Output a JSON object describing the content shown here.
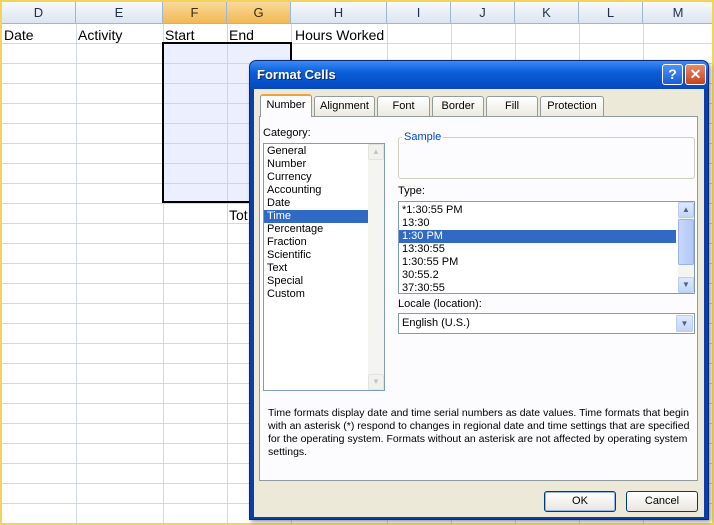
{
  "sheet": {
    "columns": [
      {
        "id": "D",
        "label": "D",
        "selected": false
      },
      {
        "id": "E",
        "label": "E",
        "selected": false
      },
      {
        "id": "F",
        "label": "F",
        "selected": true
      },
      {
        "id": "G",
        "label": "G",
        "selected": true
      },
      {
        "id": "H",
        "label": "H",
        "selected": false
      },
      {
        "id": "I",
        "label": "I",
        "selected": false
      },
      {
        "id": "J",
        "label": "J",
        "selected": false
      },
      {
        "id": "K",
        "label": "K",
        "selected": false
      },
      {
        "id": "L",
        "label": "L",
        "selected": false
      },
      {
        "id": "M",
        "label": "M",
        "selected": false
      }
    ],
    "cells": {
      "D1": "Date",
      "E1": "Activity",
      "F1": "Start",
      "G1": "End",
      "H1": "Hours Worked",
      "G10": "Tot"
    },
    "selection_color": "#000000",
    "header_selected_color": "#f1b953",
    "border_color": "#f2d35c"
  },
  "dialog": {
    "title": "Format Cells",
    "help_label": "?",
    "close_label": "✕",
    "tabs": [
      {
        "id": "number",
        "label": "Number",
        "active": true
      },
      {
        "id": "alignment",
        "label": "Alignment",
        "active": false
      },
      {
        "id": "font",
        "label": "Font",
        "active": false
      },
      {
        "id": "border",
        "label": "Border",
        "active": false
      },
      {
        "id": "fill",
        "label": "Fill",
        "active": false
      },
      {
        "id": "protection",
        "label": "Protection",
        "active": false
      }
    ],
    "category": {
      "label": "Category:",
      "items": [
        "General",
        "Number",
        "Currency",
        "Accounting",
        "Date",
        "Time",
        "Percentage",
        "Fraction",
        "Scientific",
        "Text",
        "Special",
        "Custom"
      ],
      "selected": "Time"
    },
    "sample": {
      "label": "Sample",
      "value": ""
    },
    "type": {
      "label": "Type:",
      "items": [
        "*1:30:55 PM",
        "13:30",
        "1:30 PM",
        "13:30:55",
        "1:30:55 PM",
        "30:55.2",
        "37:30:55"
      ],
      "selected": "1:30 PM"
    },
    "locale": {
      "label": "Locale (location):",
      "value": "English (U.S.)"
    },
    "description": "Time formats display date and time serial numbers as date values.  Time formats that begin with an asterisk (*) respond to changes in regional date and time settings that are specified for the operating system. Formats without an asterisk are not affected by operating system settings.",
    "ok_label": "OK",
    "cancel_label": "Cancel",
    "title_color": "#0a5fd8",
    "selection_color": "#316ac5",
    "active_tab_accent": "#f0a13c",
    "icons": {
      "help": "help-icon",
      "close": "close-icon",
      "scroll_up": "arrow-up-icon",
      "scroll_down": "arrow-down-icon",
      "dropdown": "chevron-down-icon"
    }
  }
}
